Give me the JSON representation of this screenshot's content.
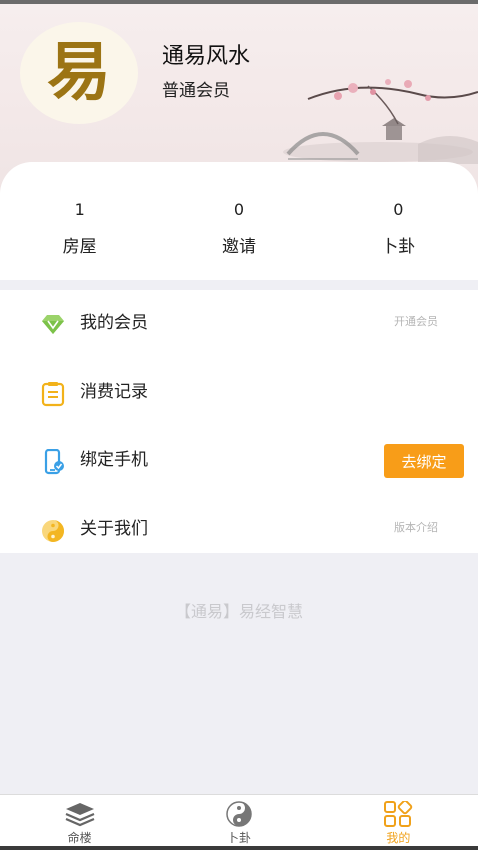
{
  "header": {
    "logo_char": "易",
    "app_name": "通易风水",
    "member_level": "普通会员"
  },
  "stats": [
    {
      "value": "1",
      "label": "房屋"
    },
    {
      "value": "0",
      "label": "邀请"
    },
    {
      "value": "0",
      "label": "卜卦"
    }
  ],
  "menu": {
    "membership": {
      "label": "我的会员",
      "right": "开通会员",
      "icon": "diamond-icon"
    },
    "records": {
      "label": "消费记录",
      "icon": "clipboard-icon"
    },
    "phone": {
      "label": "绑定手机",
      "button": "去绑定",
      "icon": "phone-icon"
    },
    "about": {
      "label": "关于我们",
      "right": "版本介绍",
      "icon": "yin-yang-icon"
    }
  },
  "slogan": "【通易】易经智慧",
  "tabs": [
    {
      "label": "命楼",
      "icon": "layers-icon",
      "active": false
    },
    {
      "label": "卜卦",
      "icon": "yin-yang-icon",
      "active": false
    },
    {
      "label": "我的",
      "icon": "grid-icon",
      "active": true
    }
  ],
  "colors": {
    "accent": "#f89d18",
    "active_tab": "#f0a11a",
    "logo": "#9c7414"
  }
}
